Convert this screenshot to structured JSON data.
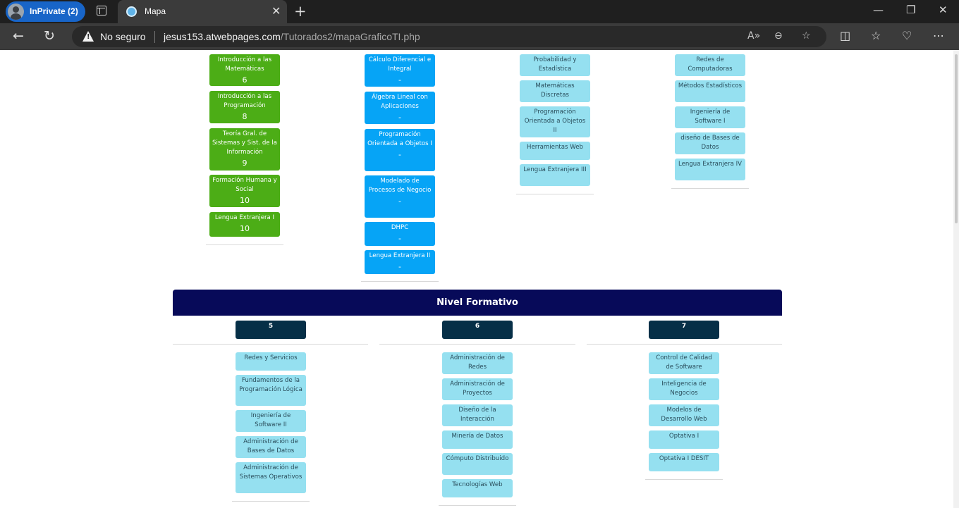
{
  "browser": {
    "inprivate_label": "InPrivate (2)",
    "tab_title": "Mapa",
    "security_label": "No seguro",
    "url_host": "jesus153.atwebpages.com",
    "url_path": "/Tutorados2/mapaGraficoTI.php"
  },
  "page": {
    "col1": {
      "items": [
        {
          "label": "Introducción a las Matemáticas",
          "value": "6"
        },
        {
          "label": "Introducción a las Programación",
          "value": "8"
        },
        {
          "label": "Teoría Gral. de Sistemas y Sist. de la Información",
          "value": "9"
        },
        {
          "label": "Formación Humana y Social",
          "value": "10"
        },
        {
          "label": "Lengua Extranjera I",
          "value": "10"
        }
      ]
    },
    "col2": {
      "items": [
        {
          "label": "Cálculo Diferencial e Integral",
          "value": "-"
        },
        {
          "label": "Álgebra Lineal con Aplicaciones",
          "value": "-"
        },
        {
          "label": "Programación Orientada a Objetos I",
          "value": "-"
        },
        {
          "label": "Modelado de Procesos de Negocio",
          "value": "-"
        },
        {
          "label": "DHPC",
          "value": "-"
        },
        {
          "label": "Lengua Extranjera II",
          "value": "-"
        }
      ]
    },
    "col3": {
      "items": [
        "Probabilidad y Estadística",
        "Matemáticas Discretas",
        "Programación Orientada a Objetos II",
        "Herramientas Web",
        "Lengua Extranjera III"
      ]
    },
    "col4": {
      "items": [
        "Redes de Computadoras",
        "Métodos Estadísticos",
        "Ingeniería de Software I",
        "diseño de Bases de Datos",
        "Lengua Extranjera IV"
      ]
    },
    "section_title": "Nivel Formativo",
    "semesters": [
      {
        "label": "5",
        "items": [
          "Redes y Servicios",
          "Fundamentos de la Programación Lógica",
          "Ingeniería de Software II",
          "Administración de Bases de Datos",
          "Administración de Sistemas Operativos"
        ]
      },
      {
        "label": "6",
        "items": [
          "Administración de Redes",
          "Administración de Proyectos",
          "Diseño de la Interacción",
          "Minería de Datos",
          "Cómputo Distribuido",
          "Tecnologías Web"
        ]
      },
      {
        "label": "7",
        "items": [
          "Control de Calidad de Software",
          "Inteligencia de Negocios",
          "Modelos de Desarrollo Web",
          "Optativa I",
          "Optativa I DESIT"
        ]
      }
    ]
  }
}
